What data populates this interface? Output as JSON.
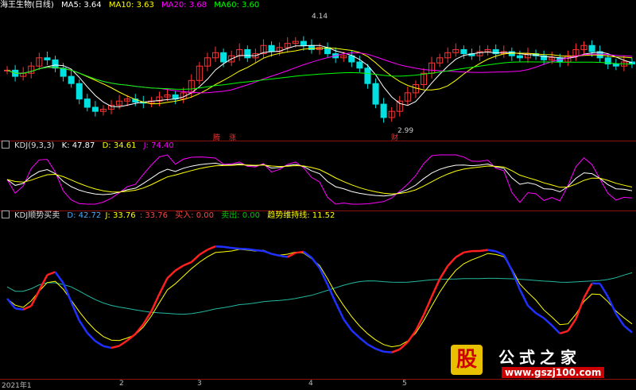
{
  "price_panel": {
    "stock_name": "海王生物(日线)",
    "ma": [
      {
        "label": "MA5: 3.64",
        "color": "#ffffff"
      },
      {
        "label": "MA10: 3.63",
        "color": "#ffff00"
      },
      {
        "label": "MA20: 3.68",
        "color": "#ff00ff"
      },
      {
        "label": "MA60: 3.60",
        "color": "#00ff00"
      }
    ],
    "high_label": "4.14",
    "low_label": "2.99",
    "flags": [
      "腾",
      "涨",
      "财"
    ],
    "up_color": "#ff3333",
    "down_color": "#00e0e0"
  },
  "kdj_panel": {
    "title": "KDJ(9,3,3)",
    "k": "K: 47.87",
    "d": "D: 34.61",
    "j": "J: 74.40"
  },
  "ind_panel": {
    "title": "KDJ顺势买卖",
    "d": "D: 42.72",
    "j": "J: 33.76",
    "j2": ": 33.76",
    "buy": "买入: 0.00",
    "sell": "卖出: 0.00",
    "trend": "趋势维持线: 11.52"
  },
  "date_axis": [
    "2021年1",
    "2",
    "3",
    "4",
    "5"
  ],
  "watermark": {
    "glyph": "股",
    "name": "公式之家",
    "url": "www.gszj100.com"
  },
  "chart_data": [
    {
      "type": "candlestick",
      "title": "海王生物(日线)",
      "series": [
        {
          "name": "MA5",
          "last": 3.64
        },
        {
          "name": "MA10",
          "last": 3.63
        },
        {
          "name": "MA20",
          "last": 3.68
        },
        {
          "name": "MA60",
          "last": 3.6
        }
      ],
      "annotations": [
        {
          "label": "4.14",
          "kind": "high"
        },
        {
          "label": "2.99",
          "kind": "low"
        }
      ],
      "close": [
        3.58,
        3.52,
        3.55,
        3.62,
        3.7,
        3.68,
        3.6,
        3.52,
        3.45,
        3.3,
        3.22,
        3.18,
        3.2,
        3.24,
        3.28,
        3.3,
        3.27,
        3.26,
        3.28,
        3.32,
        3.34,
        3.3,
        3.36,
        3.48,
        3.62,
        3.7,
        3.75,
        3.66,
        3.72,
        3.78,
        3.7,
        3.74,
        3.82,
        3.76,
        3.8,
        3.84,
        3.86,
        3.82,
        3.78,
        3.8,
        3.74,
        3.7,
        3.72,
        3.66,
        3.6,
        3.45,
        3.25,
        3.12,
        3.18,
        3.28,
        3.36,
        3.44,
        3.55,
        3.65,
        3.7,
        3.75,
        3.78,
        3.74,
        3.72,
        3.76,
        3.78,
        3.74,
        3.76,
        3.72,
        3.7,
        3.74,
        3.72,
        3.68,
        3.7,
        3.66,
        3.72,
        3.78,
        3.82,
        3.76,
        3.7,
        3.64,
        3.62,
        3.66,
        3.64
      ]
    },
    {
      "type": "line",
      "title": "KDJ(9,3,3)",
      "series": [
        {
          "name": "K",
          "last": 47.87
        },
        {
          "name": "D",
          "last": 34.61
        },
        {
          "name": "J",
          "last": 74.4
        }
      ]
    },
    {
      "type": "line",
      "title": "KDJ顺势买卖",
      "series": [
        {
          "name": "D",
          "last": 42.72
        },
        {
          "name": "J",
          "last": 33.76
        },
        {
          "name": "趋势维持线",
          "last": 11.52
        }
      ]
    }
  ]
}
